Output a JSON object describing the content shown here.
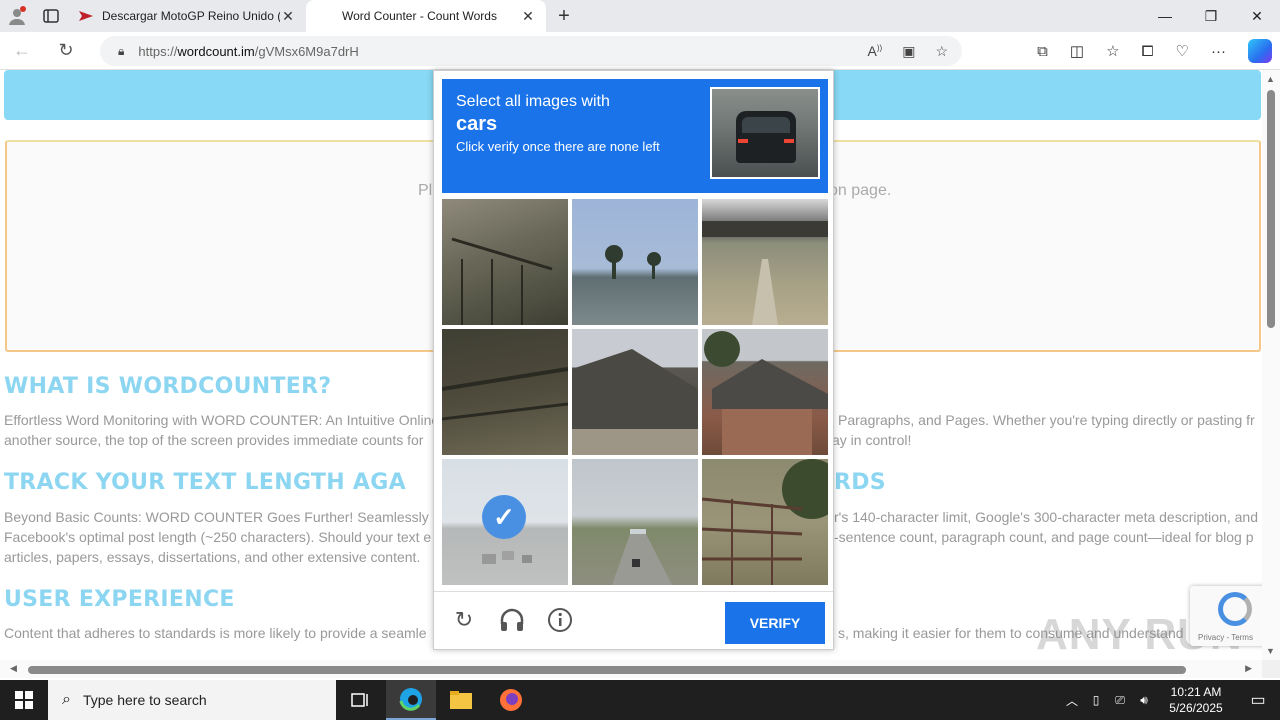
{
  "browser": {
    "tabs": [
      {
        "title": "Descargar MotoGP Reino Unido (",
        "active": false
      },
      {
        "title": "Word Counter - Count Words",
        "active": true
      }
    ],
    "url_prefix": "https://",
    "url_host": "wordcount.im",
    "url_path": "/gVMsx6M9a7drH"
  },
  "page": {
    "editor_placeholder_left": "Ple",
    "editor_placeholder_right": "on page.",
    "sections": [
      {
        "heading": "WHAT IS WORDCOUNTER?",
        "text_line1_left": "Effortless Word Monitoring with WORD COUNTER: An Intuitive Online",
        "text_line1_right": "Paragraphs, and Pages. Whether you're typing directly or pasting fr",
        "text_line2_left": "another source, the top of the screen provides immediate counts for",
        "text_line2_right": "ay in control!"
      },
      {
        "heading_left": "TRACK YOUR TEXT LENGTH AGA",
        "heading_right": "RDS",
        "text_line1_left": "Beyond Basic Counts: WORD COUNTER Goes Further! Seamlessly",
        "text_line1_right": "r's 140-character limit, Google's 300-character meta description, and",
        "text_line2_left": "Facebook's optimal post length (~250 characters). Should your text e",
        "text_line2_right": "-sentence count, paragraph count, and page count—ideal for blog p",
        "text_line3_left": "articles, papers, essays, dissertations, and other extensive content."
      },
      {
        "heading": "USER EXPERIENCE",
        "text_line1_left": "Content that adheres to standards is more likely to provide a seamle",
        "text_line1_right": "s, making it easier for them to consume and understand"
      }
    ],
    "recaptcha_links": "Privacy - Terms",
    "watermark": "ANY RUN"
  },
  "captcha": {
    "instruction": "Select all images with",
    "target": "cars",
    "hint": "Click verify once there are none left",
    "verify_label": "VERIFY",
    "tiles": [
      {
        "scene": "house-porch",
        "selected": false
      },
      {
        "scene": "palm-road",
        "selected": false
      },
      {
        "scene": "road-under-bridge",
        "selected": false
      },
      {
        "scene": "dark-roof",
        "selected": false
      },
      {
        "scene": "roof",
        "selected": false
      },
      {
        "scene": "brick-house",
        "selected": false
      },
      {
        "scene": "highway-cars",
        "selected": true
      },
      {
        "scene": "road-billboard",
        "selected": false
      },
      {
        "scene": "gate-tree",
        "selected": false
      }
    ]
  },
  "taskbar": {
    "search_placeholder": "Type here to search",
    "time": "10:21 AM",
    "date": "5/26/2025"
  }
}
